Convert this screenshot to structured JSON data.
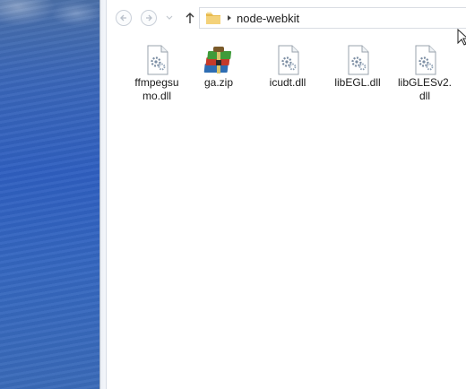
{
  "address": {
    "path": "node-webkit"
  },
  "files": [
    {
      "name": "ffmpegsumo.dll",
      "line1": "ffmpegsu",
      "line2": "mo.dll",
      "icon": "dll-icon"
    },
    {
      "name": "ga.zip",
      "line1": "ga.zip",
      "line2": "",
      "icon": "zip-icon"
    },
    {
      "name": "icudt.dll",
      "line1": "icudt.dll",
      "line2": "",
      "icon": "dll-icon"
    },
    {
      "name": "libEGL.dll",
      "line1": "libEGL.dll",
      "line2": "",
      "icon": "dll-icon"
    },
    {
      "name": "libGLESv2.dll",
      "line1": "libGLESv2.",
      "line2": "dll",
      "icon": "dll-icon"
    }
  ]
}
